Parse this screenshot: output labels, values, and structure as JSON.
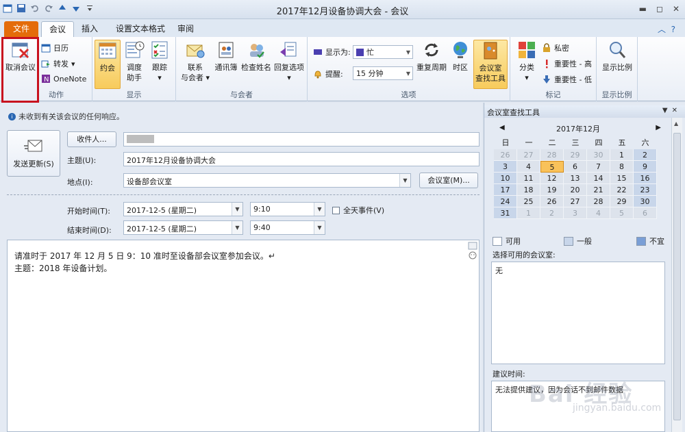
{
  "window": {
    "title": "2017年12月设备协调大会 - 会议"
  },
  "tabs": [
    {
      "label": "文件"
    },
    {
      "label": "会议"
    },
    {
      "label": "插入"
    },
    {
      "label": "设置文本格式"
    },
    {
      "label": "审阅"
    }
  ],
  "ribbon": {
    "actions": {
      "group_label": "动作",
      "cancel_meeting": "取消会议",
      "calendar": "日历",
      "forward": "转发",
      "onenote": "OneNote"
    },
    "show": {
      "group_label": "显示",
      "appointment": "约会",
      "scheduling_line1": "调度",
      "scheduling_line2": "助手",
      "tracking": "跟踪"
    },
    "attendees": {
      "group_label": "与会者",
      "contact_line1": "联系",
      "contact_line2": "与会者",
      "address_book": "通讯簿",
      "check_names": "检查姓名",
      "response_options": "回复选项"
    },
    "options": {
      "group_label": "选项",
      "show_as_label": "显示为:",
      "show_as_value": "忙",
      "reminder_label": "提醒:",
      "reminder_value": "15 分钟",
      "recurrence": "重复周期",
      "time_zones": "时区",
      "room_finder_line1": "会议室",
      "room_finder_line2": "查找工具"
    },
    "tags": {
      "group_label": "标记",
      "categorize": "分类",
      "private": "私密",
      "high_importance": "重要性 - 高",
      "low_importance": "重要性 - 低"
    },
    "zoom": {
      "group_label": "显示比例",
      "zoom": "显示比例"
    }
  },
  "form": {
    "info_bar": "未收到有关该会议的任何响应。",
    "send_update": "发送更新(S)",
    "to_button": "收件人...",
    "subject_label": "主题(U):",
    "subject_value": "2017年12月设备协调大会",
    "location_label": "地点(I):",
    "location_value": "设备部会议室",
    "rooms_button": "会议室(M)...",
    "start_label": "开始时间(T):",
    "start_date": "2017-12-5 (星期二)",
    "start_time": "9:10",
    "all_day": "全天事件(V)",
    "end_label": "结束时间(D):",
    "end_date": "2017-12-5 (星期二)",
    "end_time": "9:40",
    "body_line1": "请准时于 2017 年 12 月 5 日  9：10 准时至设备部会议室参加会议。↵",
    "body_line2": "主题：2018 年设备计划。"
  },
  "room_finder": {
    "title": "会议室查找工具",
    "month": "2017年12月",
    "weekdays": [
      "日",
      "一",
      "二",
      "三",
      "四",
      "五",
      "六"
    ],
    "weeks": [
      [
        "26",
        "27",
        "28",
        "29",
        "30",
        "1",
        "2"
      ],
      [
        "3",
        "4",
        "5",
        "6",
        "7",
        "8",
        "9"
      ],
      [
        "10",
        "11",
        "12",
        "13",
        "14",
        "15",
        "16"
      ],
      [
        "17",
        "18",
        "19",
        "20",
        "21",
        "22",
        "23"
      ],
      [
        "24",
        "25",
        "26",
        "27",
        "28",
        "29",
        "30"
      ],
      [
        "31",
        "1",
        "2",
        "3",
        "4",
        "5",
        "6"
      ]
    ],
    "legend_free": "可用",
    "legend_fair": "一般",
    "legend_poor": "不宜",
    "rooms_label": "选择可用的会议室:",
    "rooms_value": "无",
    "suggested_label": "建议时间:",
    "suggested_value": "无法提供建议，因为会话不到邮件数据"
  },
  "colors": {
    "file_tab": "#e46c0a",
    "selected": "#f9c25a",
    "highlight_box": "#c8101e"
  }
}
